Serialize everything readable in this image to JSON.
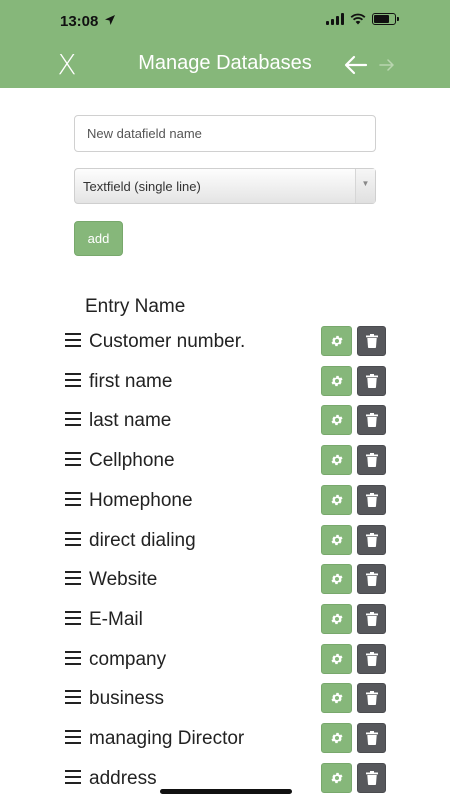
{
  "status_bar": {
    "time": "13:08",
    "battery_level": 0.75
  },
  "nav": {
    "close_label": "X",
    "title": "Manage Databases",
    "back_icon": "arrow-left-icon",
    "forward_icon": "arrow-right-icon"
  },
  "form": {
    "name_placeholder": "New datafield name",
    "name_value": "",
    "type_selected": "Textfield (single line)",
    "add_label": "add"
  },
  "list": {
    "header": "Entry Name",
    "items": [
      "Customer number.",
      "first name",
      "last name",
      "Cellphone",
      "Homephone",
      "direct dialing",
      "Website",
      "E-Mail",
      "company",
      "business",
      "managing Director",
      "address"
    ]
  },
  "colors": {
    "accent": "#86b77a",
    "delete": "#57585c"
  }
}
